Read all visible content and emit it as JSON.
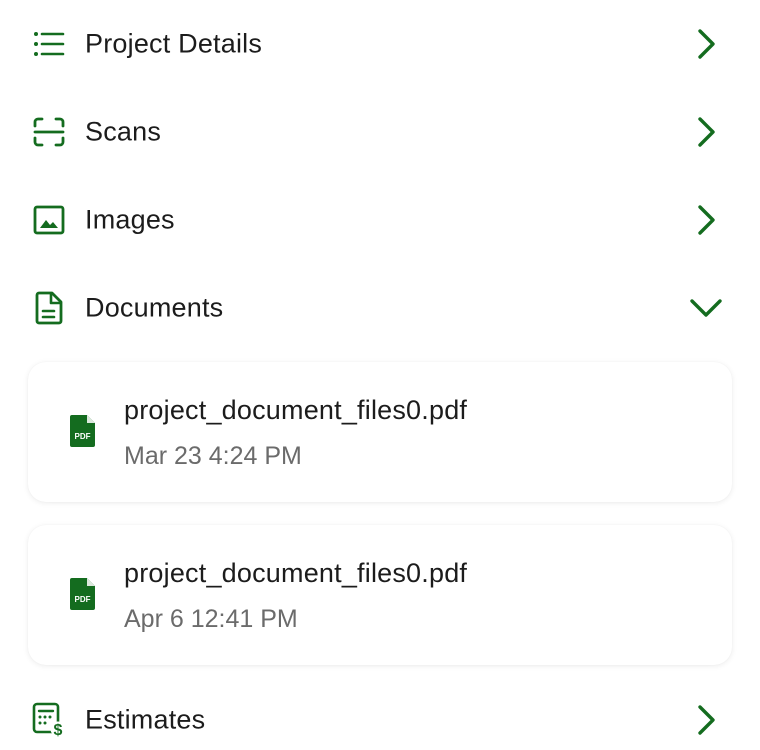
{
  "accent_color": "#146c1f",
  "sections": [
    {
      "label": "Project Details",
      "icon": "list-icon",
      "state": "collapsed"
    },
    {
      "label": "Scans",
      "icon": "scan-icon",
      "state": "collapsed"
    },
    {
      "label": "Images",
      "icon": "image-icon",
      "state": "collapsed"
    },
    {
      "label": "Documents",
      "icon": "document-icon",
      "state": "expanded"
    },
    {
      "label": "Estimates",
      "icon": "estimate-icon",
      "state": "collapsed"
    }
  ],
  "documents": [
    {
      "name": "project_document_files0.pdf",
      "date": "Mar 23 4:24 PM",
      "icon": "pdf-icon",
      "icon_text": "PDF"
    },
    {
      "name": "project_document_files0.pdf",
      "date": "Apr 6 12:41 PM",
      "icon": "pdf-icon",
      "icon_text": "PDF"
    }
  ]
}
